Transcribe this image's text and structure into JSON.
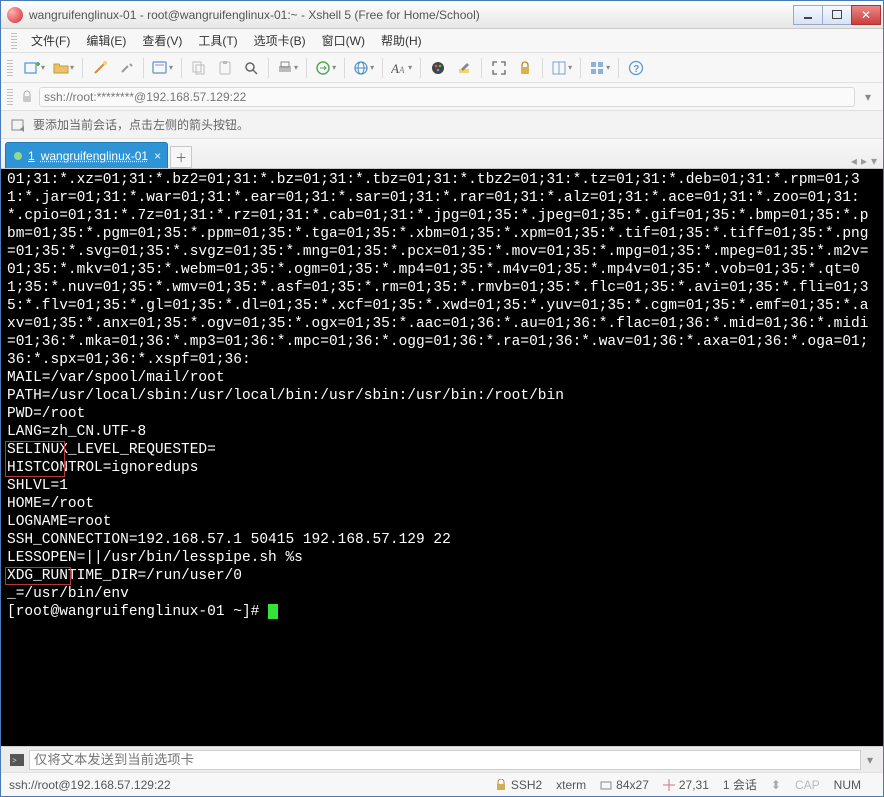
{
  "titlebar": {
    "text": "wangruifenglinux-01 - root@wangruifenglinux-01:~ - Xshell 5 (Free for Home/School)"
  },
  "menu": {
    "file": "文件(F)",
    "edit": "编辑(E)",
    "view": "查看(V)",
    "tools": "工具(T)",
    "tab": "选项卡(B)",
    "window": "窗口(W)",
    "help": "帮助(H)"
  },
  "address": {
    "text": "ssh://root:********@192.168.57.129:22"
  },
  "tipbar": {
    "text": "要添加当前会话，点击左侧的箭头按钮。"
  },
  "tab": {
    "index": "1",
    "label": "wangruifenglinux-01"
  },
  "term_lines": "01;31:*.xz=01;31:*.bz2=01;31:*.bz=01;31:*.tbz=01;31:*.tbz2=01;31:*.tz=01;31:*.deb=01;31:*.rpm=01;31:*.jar=01;31:*.war=01;31:*.ear=01;31:*.sar=01;31:*.rar=01;31:*.alz=01;31:*.ace=01;31:*.zoo=01;31:*.cpio=01;31:*.7z=01;31:*.rz=01;31:*.cab=01;31:*.jpg=01;35:*.jpeg=01;35:*.gif=01;35:*.bmp=01;35:*.pbm=01;35:*.pgm=01;35:*.ppm=01;35:*.tga=01;35:*.xbm=01;35:*.xpm=01;35:*.tif=01;35:*.tiff=01;35:*.png=01;35:*.svg=01;35:*.svgz=01;35:*.mng=01;35:*.pcx=01;35:*.mov=01;35:*.mpg=01;35:*.mpeg=01;35:*.m2v=01;35:*.mkv=01;35:*.webm=01;35:*.ogm=01;35:*.mp4=01;35:*.m4v=01;35:*.mp4v=01;35:*.vob=01;35:*.qt=01;35:*.nuv=01;35:*.wmv=01;35:*.asf=01;35:*.rm=01;35:*.rmvb=01;35:*.flc=01;35:*.avi=01;35:*.fli=01;35:*.flv=01;35:*.gl=01;35:*.dl=01;35:*.xcf=01;35:*.xwd=01;35:*.yuv=01;35:*.cgm=01;35:*.emf=01;35:*.axv=01;35:*.anx=01;35:*.ogv=01;35:*.ogx=01;35:*.aac=01;36:*.au=01;36:*.flac=01;36:*.mid=01;36:*.midi=01;36:*.mka=01;36:*.mp3=01;36:*.mpc=01;36:*.ogg=01;36:*.ra=01;36:*.wav=01;36:*.axa=01;36:*.oga=01;36:*.spx=01;36:*.xspf=01;36:\nMAIL=/var/spool/mail/root\nPATH=/usr/local/sbin:/usr/local/bin:/usr/sbin:/usr/bin:/root/bin\nPWD=/root\nLANG=zh_CN.UTF-8\nSELINUX_LEVEL_REQUESTED=\nHISTCONTROL=ignoredups\nSHLVL=1\nHOME=/root\nLOGNAME=root\nSSH_CONNECTION=192.168.57.1 50415 192.168.57.129 22\nLESSOPEN=||/usr/bin/lesspipe.sh %s\nXDG_RUNTIME_DIR=/run/user/0\n_=/usr/bin/env",
  "prompt": "[root@wangruifenglinux-01 ~]# ",
  "sendbar": {
    "placeholder": "仅将文本发送到当前选项卡"
  },
  "status": {
    "conn": "ssh://root@192.168.57.129:22",
    "ssh": "SSH2",
    "term": "xterm",
    "size": "84x27",
    "pos": "27,31",
    "sess": "1 会话",
    "cap": "CAP",
    "num": "NUM"
  }
}
